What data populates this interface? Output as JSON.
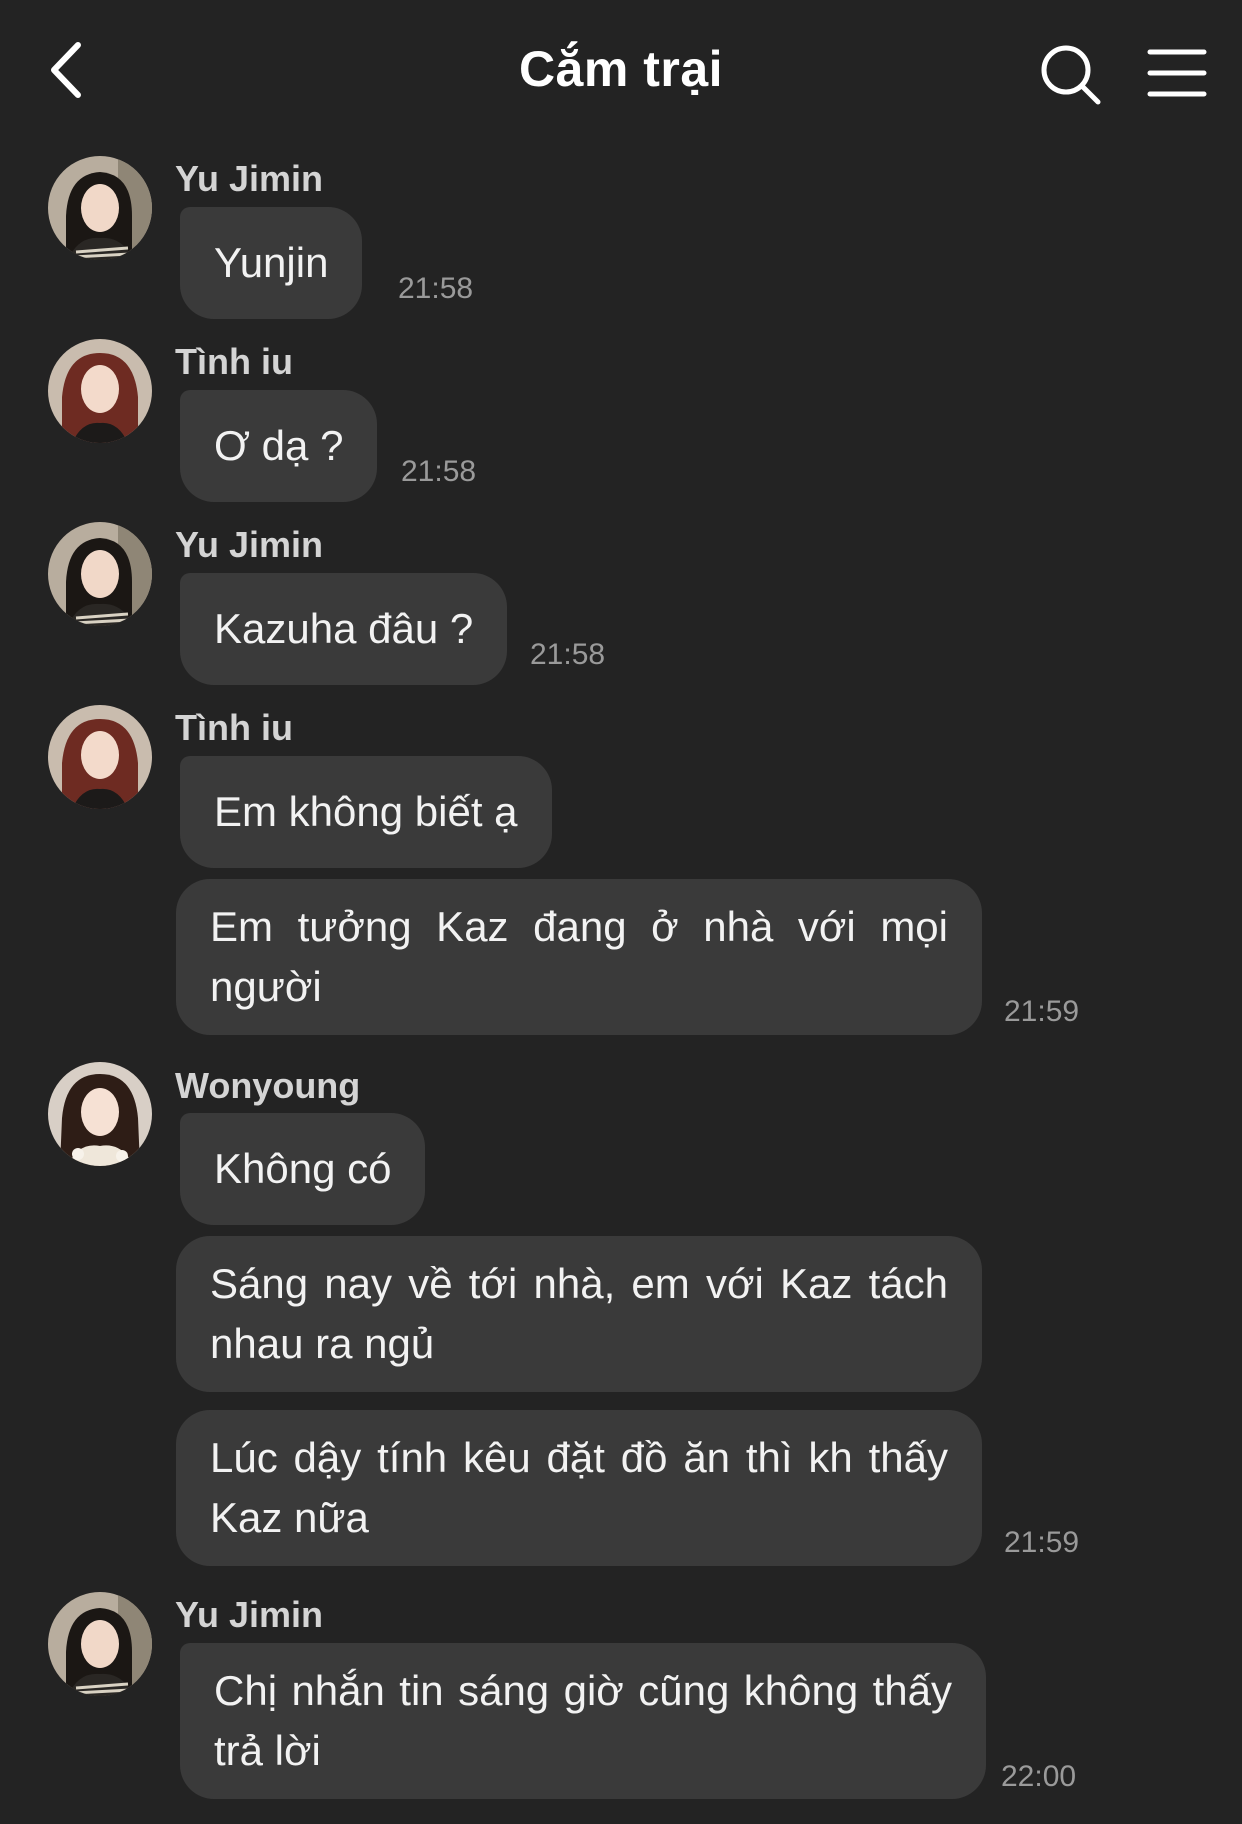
{
  "header": {
    "title": "Cắm trại",
    "back_icon": "chevron-left-icon",
    "search_icon": "search-icon",
    "menu_icon": "hamburger-menu-icon"
  },
  "messages": [
    {
      "sender": "Yu Jimin",
      "text": "Yunjin",
      "time": "21:58"
    },
    {
      "sender": "Tình iu",
      "text": "Ơ dạ ?",
      "time": "21:58"
    },
    {
      "sender": "Yu Jimin",
      "text": "Kazuha đâu ?",
      "time": "21:58"
    },
    {
      "sender": "Tình iu",
      "text": "Em không biết ạ"
    },
    {
      "text": "Em tưởng Kaz đang ở nhà với mọi người",
      "time": "21:59"
    },
    {
      "sender": "Wonyoung",
      "text": "Không có"
    },
    {
      "text": "Sáng nay về tới nhà, em với Kaz tách nhau ra ngủ"
    },
    {
      "text": "Lúc dậy tính kêu đặt đồ ăn thì kh thấy Kaz nữa",
      "time": "21:59"
    },
    {
      "sender": "Yu Jimin",
      "text": "Chị nhắn tin sáng giờ cũng không thấy trả lời",
      "time": "22:00"
    }
  ],
  "colors": {
    "background": "#232323",
    "bubble": "#3a3a3a",
    "time_text": "#9a9a9a"
  }
}
